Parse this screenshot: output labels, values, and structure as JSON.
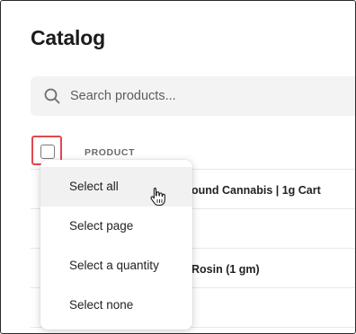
{
  "page": {
    "title": "Catalog"
  },
  "search": {
    "placeholder": "Search products..."
  },
  "table": {
    "header": {
      "product": "PRODUCT"
    },
    "rows": [
      {
        "name": "ound Cannabis | 1g Cart"
      },
      {
        "name": ""
      },
      {
        "name": "Rosin (1 gm)"
      },
      {
        "name": ""
      }
    ]
  },
  "select_menu": {
    "items": [
      {
        "label": "Select all",
        "hovered": true
      },
      {
        "label": "Select page"
      },
      {
        "label": "Select a quantity"
      },
      {
        "label": "Select none"
      }
    ]
  },
  "colors": {
    "highlight_border": "#e0484f",
    "menu_hover": "#f1f1f1"
  },
  "icons": {
    "search": "search-icon",
    "cursor": "pointer-hand-icon"
  }
}
